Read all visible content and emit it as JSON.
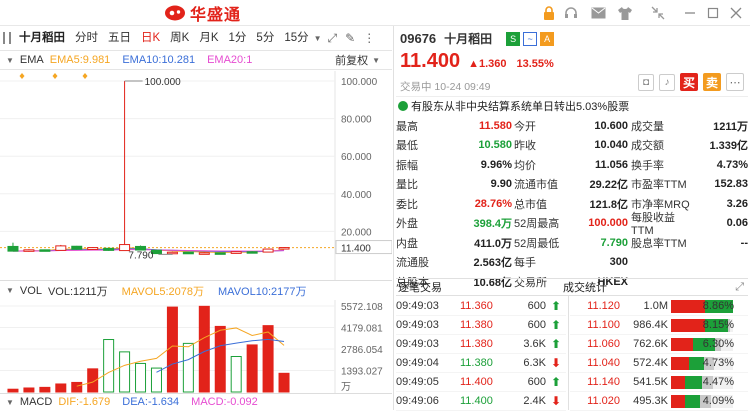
{
  "app": {
    "brand": "华盛通"
  },
  "chart_toolbar": {
    "stock_name": "十月稻田",
    "tabs": [
      {
        "label": "分时"
      },
      {
        "label": "五日"
      },
      {
        "label": "日K"
      },
      {
        "label": "周K"
      },
      {
        "label": "月K"
      },
      {
        "label": "1分"
      },
      {
        "label": "5分"
      },
      {
        "label": "15分"
      }
    ],
    "active_tab": "日K"
  },
  "ema": {
    "label": "EMA",
    "ema5": "EMA5:9.981",
    "ema10": "EMA10:10.281",
    "ema20": "EMA20:1",
    "adjust": "前复权"
  },
  "kline": {
    "y_labels": [
      "100.000",
      "80.000",
      "60.000",
      "40.000",
      "20.000",
      "11.400"
    ],
    "high_label": "100.000",
    "low_label": "7.790",
    "last_price": 11.4
  },
  "vol": {
    "label": "VOL",
    "vol": "VOL:1211万",
    "mavol5": "MAVOL5:2078万",
    "mavol10": "MAVOL10:2177万",
    "y_labels": [
      "5572.108",
      "4179.081",
      "2786.054",
      "1393.027",
      "万"
    ]
  },
  "macd": {
    "label": "MACD",
    "dif": "DIF:-1.679",
    "dea": "DEA:-1.634",
    "macd": "MACD:-0.092"
  },
  "chart_data": [
    {
      "type": "candlestick",
      "title": "",
      "ylim": [
        0,
        100
      ],
      "y_ticks": [
        100,
        80,
        60,
        40,
        20
      ],
      "candles": [
        {
          "o": 12.0,
          "c": 9.5,
          "h": 14.0,
          "l": 9.3
        },
        {
          "o": 9.5,
          "c": 10.2,
          "h": 10.5,
          "l": 9.2
        },
        {
          "o": 10.2,
          "c": 9.8,
          "h": 10.4,
          "l": 9.6
        },
        {
          "o": 9.9,
          "c": 12.3,
          "h": 12.8,
          "l": 9.8
        },
        {
          "o": 12.1,
          "c": 10.5,
          "h": 12.3,
          "l": 10.2
        },
        {
          "o": 10.4,
          "c": 11.4,
          "h": 11.6,
          "l": 10.2
        },
        {
          "o": 11.0,
          "c": 9.9,
          "h": 11.2,
          "l": 9.7
        },
        {
          "o": 9.8,
          "c": 13.0,
          "h": 100.0,
          "l": 9.7
        },
        {
          "o": 12.0,
          "c": 10.1,
          "h": 12.5,
          "l": 9.9
        },
        {
          "o": 10.0,
          "c": 8.2,
          "h": 10.2,
          "l": 8.0
        },
        {
          "o": 8.1,
          "c": 8.9,
          "h": 9.2,
          "l": 7.79
        },
        {
          "o": 8.9,
          "c": 8.4,
          "h": 9.1,
          "l": 8.2
        },
        {
          "o": 8.4,
          "c": 8.6,
          "h": 8.9,
          "l": 8.2
        },
        {
          "o": 8.6,
          "c": 8.3,
          "h": 8.8,
          "l": 8.1
        },
        {
          "o": 8.3,
          "c": 9.2,
          "h": 9.4,
          "l": 8.2
        },
        {
          "o": 9.2,
          "c": 9.0,
          "h": 9.5,
          "l": 8.8
        },
        {
          "o": 9.0,
          "c": 10.6,
          "h": 10.8,
          "l": 8.9
        },
        {
          "o": 10.6,
          "c": 11.4,
          "h": 11.58,
          "l": 10.58
        }
      ]
    },
    {
      "type": "bar",
      "title": "VOL",
      "unit": "万",
      "ylim": [
        0,
        5572.108
      ],
      "values": [
        180,
        260,
        300,
        520,
        620,
        1500,
        3400,
        2600,
        1850,
        1550,
        5500,
        3150,
        5550,
        4250,
        2300,
        3050,
        4300,
        1211
      ],
      "colors": [
        "up",
        "up",
        "up",
        "up",
        "up",
        "up",
        "down",
        "down",
        "down",
        "down",
        "up",
        "down",
        "up",
        "up",
        "down",
        "up",
        "up",
        "up"
      ]
    }
  ],
  "quote": {
    "code": "09676",
    "name": "十月稻田",
    "price": "11.400",
    "change": "▲1.360",
    "change_pct": "13.55%",
    "status": "交易中 10-24 09:49",
    "badges": [
      "S",
      "~",
      "A"
    ],
    "buy_label": "买",
    "sell_label": "卖",
    "notice": "有股东从非中央结算系统单日转出5.03%股票",
    "rows": [
      [
        "最高",
        "11.580",
        "今开",
        "10.600",
        "成交量",
        "1211万"
      ],
      [
        "最低",
        "10.580",
        "昨收",
        "10.040",
        "成交额",
        "1.339亿"
      ],
      [
        "振幅",
        "9.96%",
        "均价",
        "11.056",
        "换手率",
        "4.73%"
      ],
      [
        "量比",
        "9.90",
        "流通市值",
        "29.22亿",
        "市盈率TTM",
        "152.83"
      ],
      [
        "委比",
        "28.76%",
        "总市值",
        "121.8亿",
        "市净率MRQ",
        "3.26"
      ],
      [
        "外盘",
        "398.4万",
        "52周最高",
        "100.000",
        "每股收益TTM",
        "0.06"
      ],
      [
        "内盘",
        "411.0万",
        "52周最低",
        "7.790",
        "股息率TTM",
        "--"
      ],
      [
        "流通股",
        "2.563亿",
        "每手",
        "300",
        "",
        ""
      ],
      [
        "总股本",
        "10.68亿",
        "交易所",
        "HKEX",
        "",
        ""
      ]
    ],
    "red_values": [
      "11.580",
      "28.76%",
      "100.000"
    ],
    "green_values": [
      "10.580",
      "398.4万",
      "7.790"
    ]
  },
  "trades": {
    "title": "逐笔交易",
    "items": [
      {
        "time": "09:49:03",
        "price": "11.360",
        "vol": "600",
        "dir": "up"
      },
      {
        "time": "09:49:03",
        "price": "11.380",
        "vol": "600",
        "dir": "up"
      },
      {
        "time": "09:49:03",
        "price": "11.380",
        "vol": "3.6K",
        "dir": "up"
      },
      {
        "time": "09:49:04",
        "price": "11.380",
        "vol": "6.3K",
        "dir": "down"
      },
      {
        "time": "09:49:05",
        "price": "11.400",
        "vol": "600",
        "dir": "up"
      },
      {
        "time": "09:49:06",
        "price": "11.400",
        "vol": "2.4K",
        "dir": "down"
      }
    ]
  },
  "stats": {
    "title": "成交统计",
    "items": [
      {
        "price": "11.120",
        "vol": "1.0M",
        "pct": "8.86%",
        "ratio": 0.886,
        "buy": 0.55
      },
      {
        "price": "11.100",
        "vol": "986.4K",
        "pct": "8.15%",
        "ratio": 0.815,
        "buy": 0.6
      },
      {
        "price": "11.060",
        "vol": "762.6K",
        "pct": "6.30%",
        "ratio": 0.63,
        "buy": 0.5
      },
      {
        "price": "11.040",
        "vol": "572.4K",
        "pct": "4.73%",
        "ratio": 0.473,
        "buy": 0.55
      },
      {
        "price": "11.140",
        "vol": "541.5K",
        "pct": "4.47%",
        "ratio": 0.447,
        "buy": 0.45
      },
      {
        "price": "11.020",
        "vol": "495.3K",
        "pct": "4.09%",
        "ratio": 0.409,
        "buy": 0.5
      }
    ]
  },
  "colors": {
    "up": "#e2231a",
    "down": "#1ca039",
    "ema5": "#f5a623",
    "ema10": "#3b6fd8",
    "ema20": "#e64cd1",
    "accent": "#e2231a"
  }
}
